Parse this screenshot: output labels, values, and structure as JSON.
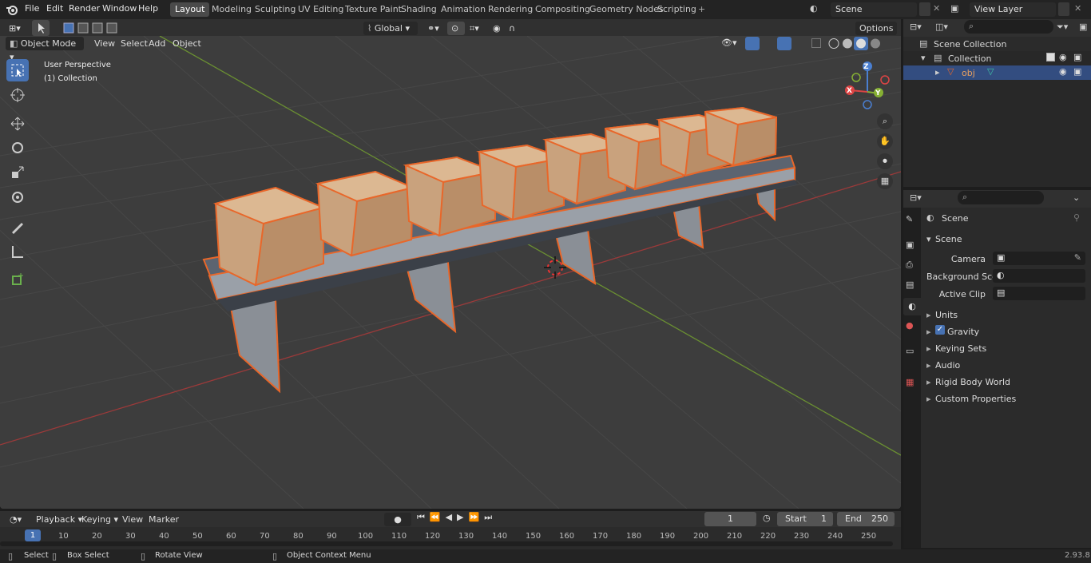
{
  "topbar": {
    "menus": [
      "File",
      "Edit",
      "Render",
      "Window",
      "Help"
    ],
    "workspaces": [
      "Layout",
      "Modeling",
      "Sculpting",
      "UV Editing",
      "Texture Paint",
      "Shading",
      "Animation",
      "Rendering",
      "Compositing",
      "Geometry Nodes",
      "Scripting"
    ],
    "active_workspace": "Layout",
    "scene": "Scene",
    "view_layer": "View Layer"
  },
  "viewport_header": {
    "mode": "Object Mode",
    "menus": [
      "View",
      "Select",
      "Add",
      "Object"
    ],
    "orientation": "Global",
    "options": "Options"
  },
  "viewport": {
    "perspective": "User Perspective",
    "collection": "(1) Collection",
    "gizmo_axes": [
      "Z",
      "Y",
      "X"
    ]
  },
  "outliner": {
    "scene_collection": "Scene Collection",
    "collection": "Collection",
    "object": "obj"
  },
  "properties": {
    "context": "Scene",
    "panel": "Scene",
    "fields": [
      {
        "label": "Camera"
      },
      {
        "label": "Background Scene"
      },
      {
        "label": "Active Clip"
      }
    ],
    "sections": [
      "Units",
      "Gravity",
      "Keying Sets",
      "Audio",
      "Rigid Body World",
      "Custom Properties"
    ]
  },
  "timeline": {
    "menus": [
      "Playback",
      "Keying",
      "View",
      "Marker"
    ],
    "current_frame": "1",
    "start_label": "Start",
    "start": "1",
    "end_label": "End",
    "end": "250",
    "ticks": [
      "1",
      "10",
      "20",
      "30",
      "40",
      "50",
      "60",
      "70",
      "80",
      "90",
      "100",
      "110",
      "120",
      "130",
      "140",
      "150",
      "160",
      "170",
      "180",
      "190",
      "200",
      "210",
      "220",
      "230",
      "240",
      "250"
    ]
  },
  "statusbar": {
    "items": [
      "Select",
      "Box Select",
      "Rotate View",
      "Object Context Menu"
    ],
    "version": "2.93.8"
  },
  "colors": {
    "accent": "#4772b3",
    "selection_outline": "#e8672a",
    "viewport_bg": "#3d3d3d"
  }
}
